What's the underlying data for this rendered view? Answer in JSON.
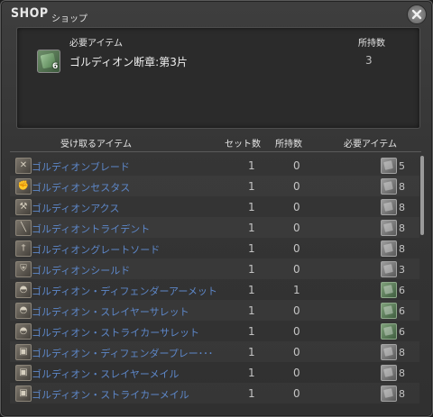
{
  "window": {
    "title": "SHOP",
    "subtitle": "ショップ"
  },
  "required": {
    "header_item": "必要アイテム",
    "header_held": "所持数",
    "item_name": "ゴルディオン断章:第3片",
    "icon_count": "6",
    "held": "3",
    "icon": "green-book-icon"
  },
  "list": {
    "headers": {
      "receive": "受け取るアイテム",
      "set_count": "セット数",
      "held": "所持数",
      "required": "必要アイテム"
    },
    "rows": [
      {
        "name": "ゴルディオンブレード",
        "icon": "sword-icon",
        "set": "1",
        "held": "0",
        "req": "5",
        "req_icon": "gray-book-icon"
      },
      {
        "name": "ゴルディオンセスタス",
        "icon": "fist-icon",
        "set": "1",
        "held": "0",
        "req": "8",
        "req_icon": "gray-book-icon"
      },
      {
        "name": "ゴルディオンアクス",
        "icon": "axe-icon",
        "set": "1",
        "held": "0",
        "req": "8",
        "req_icon": "gray-book-icon"
      },
      {
        "name": "ゴルディオントライデント",
        "icon": "spear-icon",
        "set": "1",
        "held": "0",
        "req": "8",
        "req_icon": "gray-book-icon"
      },
      {
        "name": "ゴルディオングレートソード",
        "icon": "greatsword-icon",
        "set": "1",
        "held": "0",
        "req": "8",
        "req_icon": "gray-book-icon"
      },
      {
        "name": "ゴルディオンシールド",
        "icon": "shield-icon",
        "set": "1",
        "held": "0",
        "req": "3",
        "req_icon": "gray-book-icon"
      },
      {
        "name": "ゴルディオン・ディフェンダーアーメット",
        "icon": "helmet-icon",
        "set": "1",
        "held": "1",
        "req": "6",
        "req_icon": "green-book-icon"
      },
      {
        "name": "ゴルディオン・スレイヤーサレット",
        "icon": "helmet-icon",
        "set": "1",
        "held": "0",
        "req": "6",
        "req_icon": "green-book-icon"
      },
      {
        "name": "ゴルディオン・ストライカーサレット",
        "icon": "helmet-icon",
        "set": "1",
        "held": "0",
        "req": "6",
        "req_icon": "green-book-icon"
      },
      {
        "name": "ゴルディオン・ディフェンダープレー･･･",
        "icon": "armor-icon",
        "set": "1",
        "held": "0",
        "req": "8",
        "req_icon": "gray-book-icon"
      },
      {
        "name": "ゴルディオン・スレイヤーメイル",
        "icon": "armor-icon",
        "set": "1",
        "held": "0",
        "req": "8",
        "req_icon": "gray-book-icon"
      },
      {
        "name": "ゴルディオン・ストライカーメイル",
        "icon": "armor-icon",
        "set": "1",
        "held": "0",
        "req": "8",
        "req_icon": "gray-book-icon"
      }
    ]
  },
  "colors": {
    "item_link": "#5d87c9",
    "text": "#e4e4e4",
    "background": "#353535"
  }
}
